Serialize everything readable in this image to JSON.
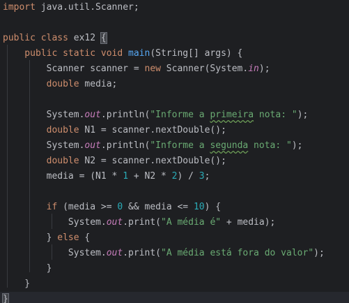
{
  "editor": {
    "language": "java",
    "colors": {
      "background": "#1e1f22",
      "keyword": "#cf8e6d",
      "function": "#56a8f5",
      "string": "#6aab73",
      "number": "#2aacb8",
      "static_field": "#c77dbb",
      "plain": "#bcbec4"
    },
    "lines": [
      [
        {
          "t": "import",
          "c": "kw"
        },
        {
          "t": " java.util.Scanner;",
          "c": "txt"
        }
      ],
      [],
      [
        {
          "t": "public class",
          "c": "kw"
        },
        {
          "t": " ex12 ",
          "c": "txt"
        },
        {
          "t": "{",
          "c": "brace"
        }
      ],
      [
        {
          "t": "    public static void ",
          "c": "kw"
        },
        {
          "t": "main",
          "c": "fn"
        },
        {
          "t": "(String[] args) {",
          "c": "txt"
        }
      ],
      [
        {
          "t": "        Scanner scanner = ",
          "c": "txt"
        },
        {
          "t": "new",
          "c": "kw"
        },
        {
          "t": " Scanner(System.",
          "c": "txt"
        },
        {
          "t": "in",
          "c": "field"
        },
        {
          "t": ");",
          "c": "txt"
        }
      ],
      [
        {
          "t": "        ",
          "c": "txt"
        },
        {
          "t": "double",
          "c": "kw"
        },
        {
          "t": " media;",
          "c": "txt"
        }
      ],
      [],
      [
        {
          "t": "        System.",
          "c": "txt"
        },
        {
          "t": "out",
          "c": "field"
        },
        {
          "t": ".println(",
          "c": "txt"
        },
        {
          "t": "\"Informe a ",
          "c": "str"
        },
        {
          "t": "primeira",
          "c": "str typo"
        },
        {
          "t": " nota: \"",
          "c": "str"
        },
        {
          "t": ");",
          "c": "txt"
        }
      ],
      [
        {
          "t": "        ",
          "c": "txt"
        },
        {
          "t": "double",
          "c": "kw"
        },
        {
          "t": " N1 = scanner.nextDouble();",
          "c": "txt"
        }
      ],
      [
        {
          "t": "        System.",
          "c": "txt"
        },
        {
          "t": "out",
          "c": "field"
        },
        {
          "t": ".println(",
          "c": "txt"
        },
        {
          "t": "\"Informe a ",
          "c": "str"
        },
        {
          "t": "segunda",
          "c": "str typo"
        },
        {
          "t": " nota: \"",
          "c": "str"
        },
        {
          "t": ");",
          "c": "txt"
        }
      ],
      [
        {
          "t": "        ",
          "c": "txt"
        },
        {
          "t": "double",
          "c": "kw"
        },
        {
          "t": " N2 = scanner.nextDouble();",
          "c": "txt"
        }
      ],
      [
        {
          "t": "        media = (N1 * ",
          "c": "txt"
        },
        {
          "t": "1",
          "c": "num"
        },
        {
          "t": " + N2 * ",
          "c": "txt"
        },
        {
          "t": "2",
          "c": "num"
        },
        {
          "t": ") / ",
          "c": "txt"
        },
        {
          "t": "3",
          "c": "num"
        },
        {
          "t": ";",
          "c": "txt"
        }
      ],
      [],
      [
        {
          "t": "        ",
          "c": "txt"
        },
        {
          "t": "if",
          "c": "kw"
        },
        {
          "t": " (media >= ",
          "c": "txt"
        },
        {
          "t": "0",
          "c": "num"
        },
        {
          "t": " && media <= ",
          "c": "txt"
        },
        {
          "t": "10",
          "c": "num"
        },
        {
          "t": ") {",
          "c": "txt"
        }
      ],
      [
        {
          "t": "            System.",
          "c": "txt"
        },
        {
          "t": "out",
          "c": "field"
        },
        {
          "t": ".print(",
          "c": "txt"
        },
        {
          "t": "\"A média é\"",
          "c": "str"
        },
        {
          "t": " + media);",
          "c": "txt"
        }
      ],
      [
        {
          "t": "        } ",
          "c": "txt"
        },
        {
          "t": "else",
          "c": "kw"
        },
        {
          "t": " {",
          "c": "txt"
        }
      ],
      [
        {
          "t": "            System.",
          "c": "txt"
        },
        {
          "t": "out",
          "c": "field"
        },
        {
          "t": ".print(",
          "c": "txt"
        },
        {
          "t": "\"A média está fora do valor\"",
          "c": "str"
        },
        {
          "t": ");",
          "c": "txt"
        }
      ],
      [
        {
          "t": "        }",
          "c": "txt"
        }
      ],
      [
        {
          "t": "    }",
          "c": "txt"
        }
      ],
      [
        {
          "t": "}",
          "c": "brace"
        }
      ]
    ]
  }
}
